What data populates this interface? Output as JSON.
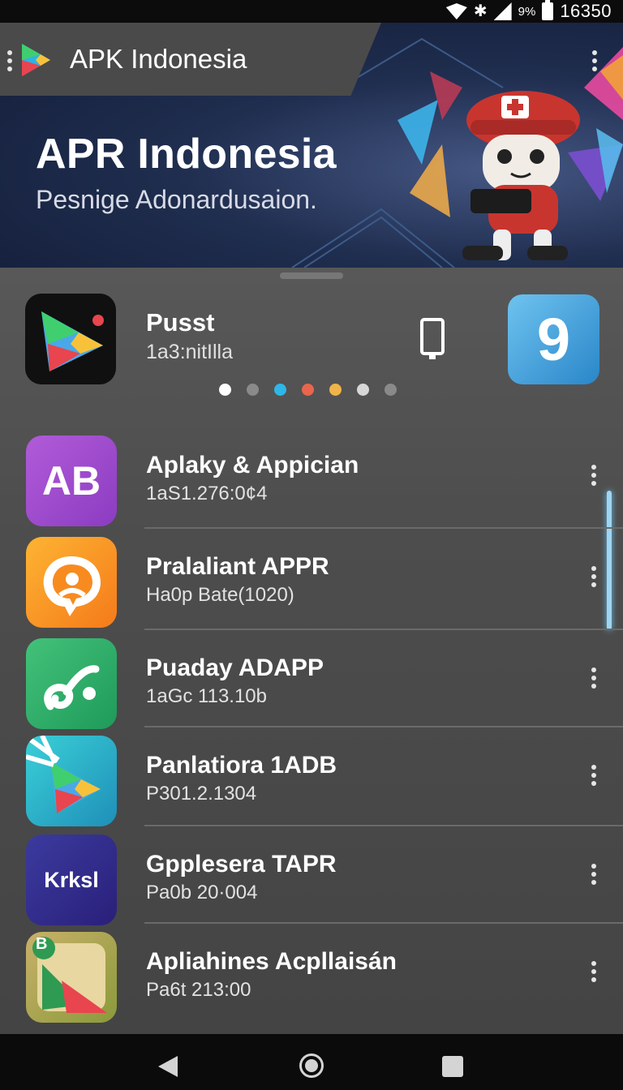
{
  "status_bar": {
    "battery_text": "9%",
    "time": "16350",
    "bluetooth_glyph": "✱"
  },
  "app_bar": {
    "title": "APK Indonesia"
  },
  "banner": {
    "title": "APR Indonesia",
    "subtitle": "Pesnige Adonardusaion."
  },
  "featured": {
    "name": "Pusst",
    "subtitle": "1a3:nitIlla",
    "second_icon_glyph": "9",
    "carousel_dots": [
      "#ffffff",
      "#8a8a8a",
      "#2fb6e8",
      "#e8664d",
      "#f0b44a",
      "#d8d8d8",
      "#8a8a8a"
    ]
  },
  "apps": [
    {
      "name": "Aplaky & Appician",
      "meta": "1aS1.276:0¢4",
      "icon_label": "AB",
      "icon_colors": [
        "#b15bd8",
        "#8c3cc2"
      ]
    },
    {
      "name": "Pralaliant APPR",
      "meta": "Ha0p Bate(1020)",
      "icon_label": "",
      "icon_colors": [
        "#fdb433",
        "#f57a1a"
      ]
    },
    {
      "name": "Puaday ADAPP",
      "meta": "1aGc 113.10b",
      "icon_label": "",
      "icon_colors": [
        "#43c27a",
        "#1f9a5a"
      ]
    },
    {
      "name": "Panlatiora 1ADB",
      "meta": "P301.2.1304",
      "icon_label": "",
      "icon_colors": [
        "#3ad0d8",
        "#1f8fb8"
      ]
    },
    {
      "name": "Gpplesera TAPR",
      "meta": "Pa0b 20·004",
      "icon_label": "Krksl",
      "icon_colors": [
        "#3b3b9e",
        "#2a1f7a"
      ]
    },
    {
      "name": "Apliahines Acpllaisán",
      "meta": "Pa6t 213:00",
      "icon_label": "B",
      "icon_colors": [
        "#c9b06a",
        "#8a9a3a"
      ]
    }
  ],
  "icons": {
    "wifi": "wifi-icon",
    "signal": "signal-icon",
    "battery": "battery-icon",
    "menu": "kebab-menu-icon",
    "back": "back-icon",
    "home": "home-icon",
    "recents": "recents-icon"
  }
}
